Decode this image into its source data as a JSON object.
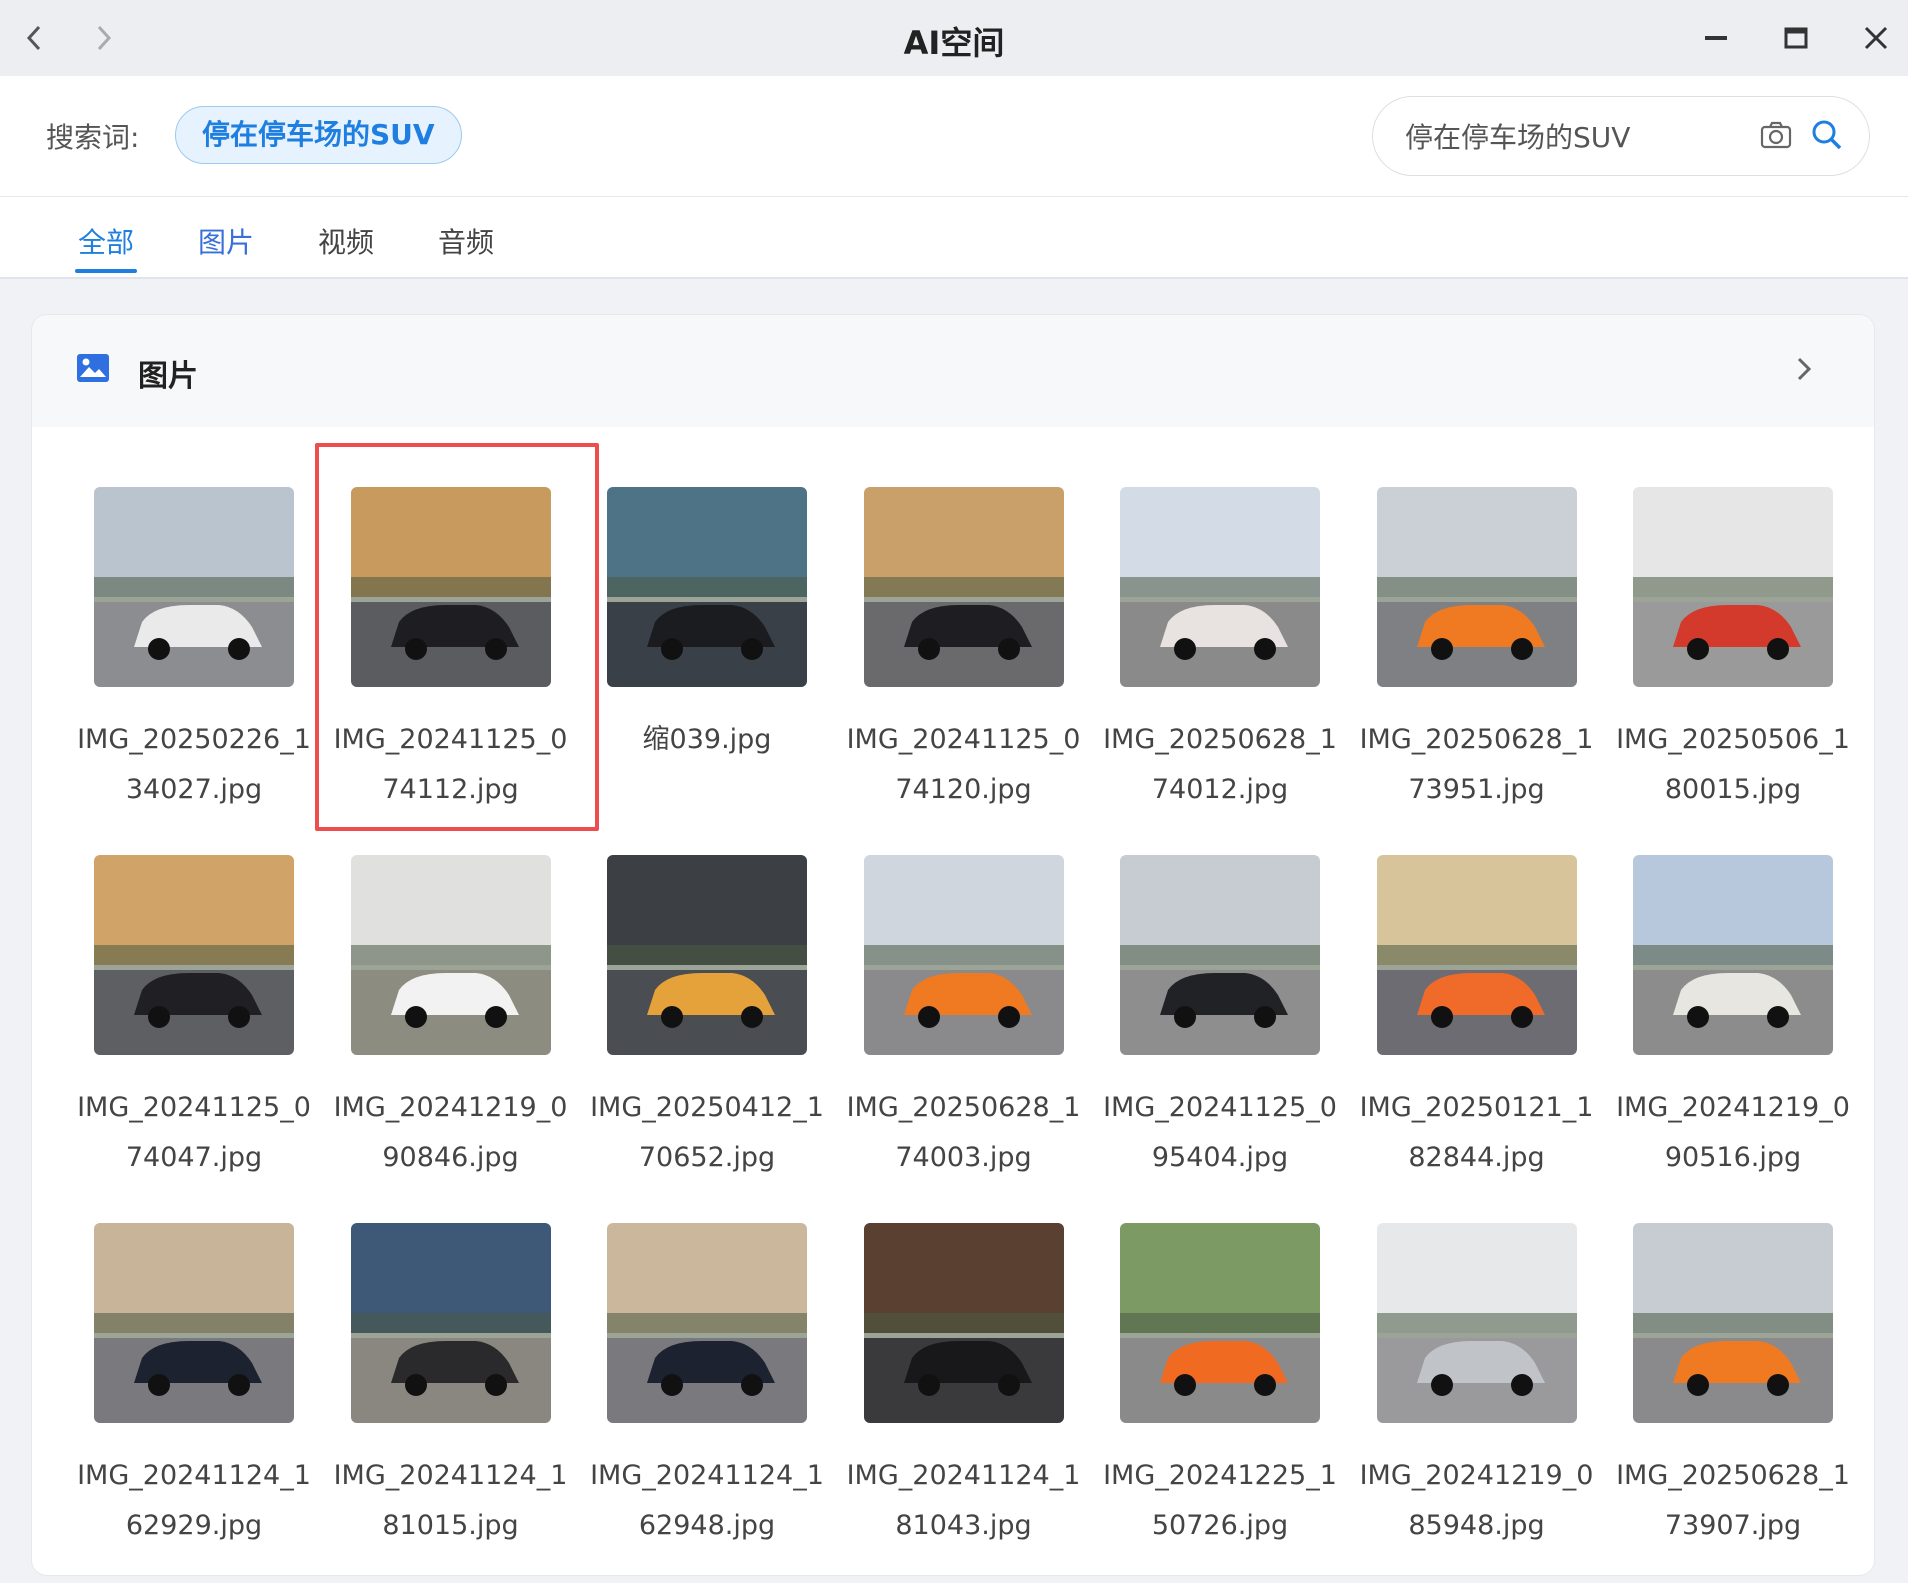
{
  "window": {
    "title": "AI空间"
  },
  "search": {
    "label": "搜索词:",
    "chip": "停在停车场的SUV",
    "value": "停在停车场的SUV"
  },
  "tabs": [
    {
      "label": "全部"
    },
    {
      "label": "图片"
    },
    {
      "label": "视频"
    },
    {
      "label": "音频"
    }
  ],
  "section": {
    "title": "图片"
  },
  "images": [
    {
      "name": "IMG_20250226_134027.jpg",
      "sky": "#b9c4cf",
      "ground": "#8b8d90",
      "car": "#eaeaea"
    },
    {
      "name": "IMG_20241125_074112.jpg",
      "sky": "#c89a5e",
      "ground": "#5a5c60",
      "car": "#1e1e22"
    },
    {
      "name": "缩039.jpg",
      "sky": "#4f7386",
      "ground": "#3a4048",
      "car": "#1a1c20"
    },
    {
      "name": "IMG_20241125_074120.jpg",
      "sky": "#caa06a",
      "ground": "#6a6a6c",
      "car": "#1e1e22"
    },
    {
      "name": "IMG_20250628_174012.jpg",
      "sky": "#d2dbe6",
      "ground": "#8a8a8a",
      "car": "#e8e2e0"
    },
    {
      "name": "IMG_20250628_173951.jpg",
      "sky": "#cbd0d6",
      "ground": "#7f8084",
      "car": "#f07a22"
    },
    {
      "name": "IMG_20250506_180015.jpg",
      "sky": "#e6e6e6",
      "ground": "#9a9a9a",
      "car": "#d33a2c"
    },
    {
      "name": "IMG_20241125_074047.jpg",
      "sky": "#d0a468",
      "ground": "#5e5f62",
      "car": "#202024"
    },
    {
      "name": "IMG_20241219_090846.jpg",
      "sky": "#e0e0de",
      "ground": "#8c8c80",
      "car": "#f2f2f2"
    },
    {
      "name": "IMG_20250412_170652.jpg",
      "sky": "#3c4044",
      "ground": "#4a4e52",
      "car": "#e6a23a"
    },
    {
      "name": "IMG_20250628_174003.jpg",
      "sky": "#cfd6de",
      "ground": "#8a8a8c",
      "car": "#f07a22"
    },
    {
      "name": "IMG_20241125_095404.jpg",
      "sky": "#c6ccd2",
      "ground": "#8e8e8e",
      "car": "#202226"
    },
    {
      "name": "IMG_20250121_182844.jpg",
      "sky": "#d8c49a",
      "ground": "#6c6c72",
      "car": "#f06a2a"
    },
    {
      "name": "IMG_20241219_090516.jpg",
      "sky": "#b8c8dc",
      "ground": "#8c8c8c",
      "car": "#e8e6e0"
    },
    {
      "name": "IMG_20241124_162929.jpg",
      "sky": "#c8b498",
      "ground": "#7a7a7e",
      "car": "#1c2230"
    },
    {
      "name": "IMG_20241124_181015.jpg",
      "sky": "#3e5878",
      "ground": "#8a8680",
      "car": "#2a2a2c"
    },
    {
      "name": "IMG_20241124_162948.jpg",
      "sky": "#cbb89c",
      "ground": "#7a7a7e",
      "car": "#1c2230"
    },
    {
      "name": "IMG_20241124_181043.jpg",
      "sky": "#5a4030",
      "ground": "#3a3a3c",
      "car": "#18181a"
    },
    {
      "name": "IMG_20241225_150726.jpg",
      "sky": "#7c9a64",
      "ground": "#8a8a8a",
      "car": "#f06a22"
    },
    {
      "name": "IMG_20241219_085948.jpg",
      "sky": "#e6e8ea",
      "ground": "#9a9a9c",
      "car": "#c0c4c8"
    },
    {
      "name": "IMG_20250628_173907.jpg",
      "sky": "#c6ccd2",
      "ground": "#8a8a8c",
      "car": "#f07a22"
    }
  ],
  "selected_index": 1,
  "colors": {
    "accent": "#1f7fe0",
    "selection": "#ee4d4d"
  }
}
